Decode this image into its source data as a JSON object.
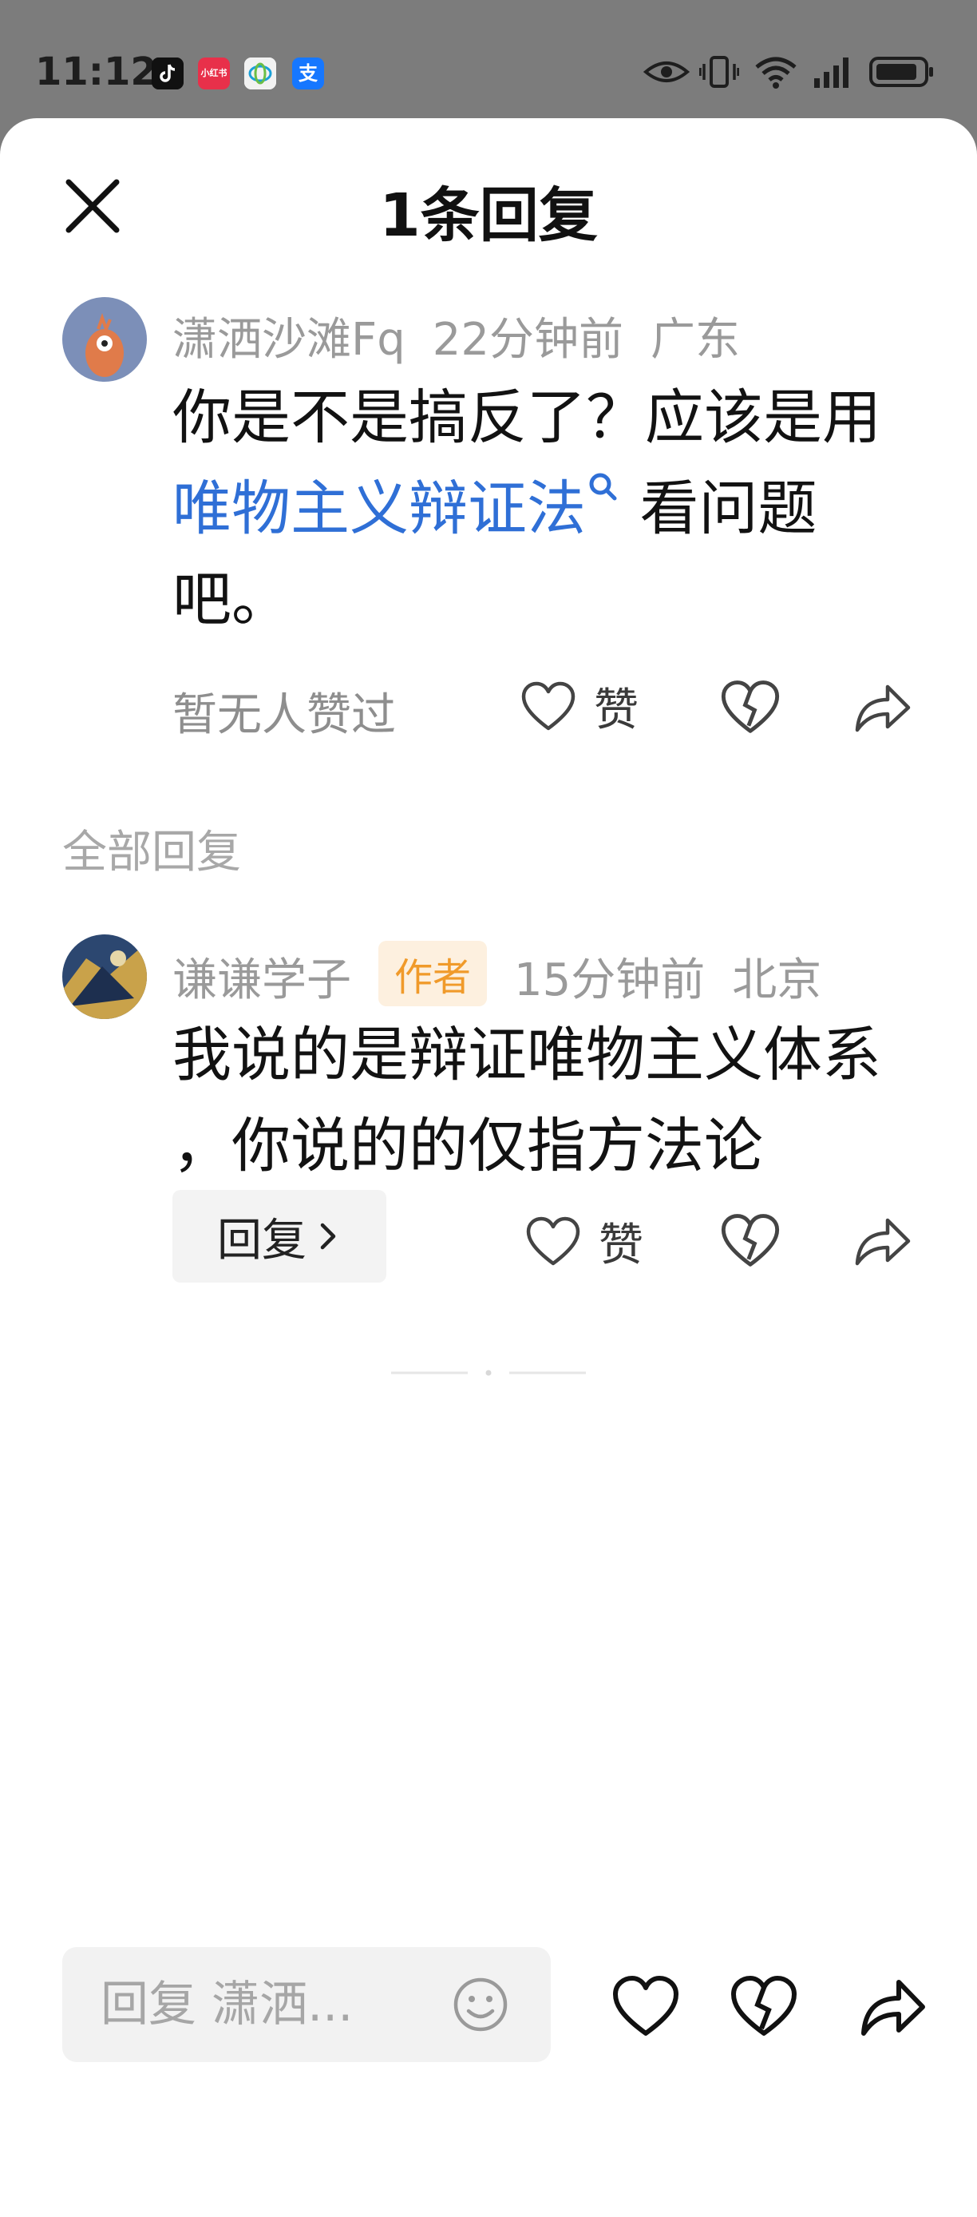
{
  "status_bar": {
    "time": "11:12",
    "apps": [
      "tiktok-icon",
      "xiaohongshu-icon",
      "china-mobile-icon",
      "alipay-icon"
    ],
    "xiaohongshu_text": "小红书",
    "alipay_text": "支"
  },
  "header": {
    "title": "1条回复"
  },
  "main_comment": {
    "username": "潇洒沙滩Fq",
    "time": "22分钟前",
    "location": "广东",
    "text_before": "你是不是搞反了？应该是用",
    "link_text": "唯物主义辩证法",
    "text_after": " 看问题吧。",
    "likes_text": "暂无人赞过",
    "like_label": "赞"
  },
  "section": {
    "all_replies": "全部回复"
  },
  "reply": {
    "username": "谦谦学子",
    "badge": "作者",
    "time": "15分钟前",
    "location": "北京",
    "text": "我说的是辩证唯物主义体系 ，你说的的仅指方法论",
    "reply_button": "回复",
    "like_label": "赞"
  },
  "bottom_bar": {
    "reply_placeholder": "回复 潇洒..."
  },
  "colors": {
    "link": "#2f6fd6",
    "badge_bg": "#fdf0df",
    "badge_text": "#f09a2a"
  }
}
